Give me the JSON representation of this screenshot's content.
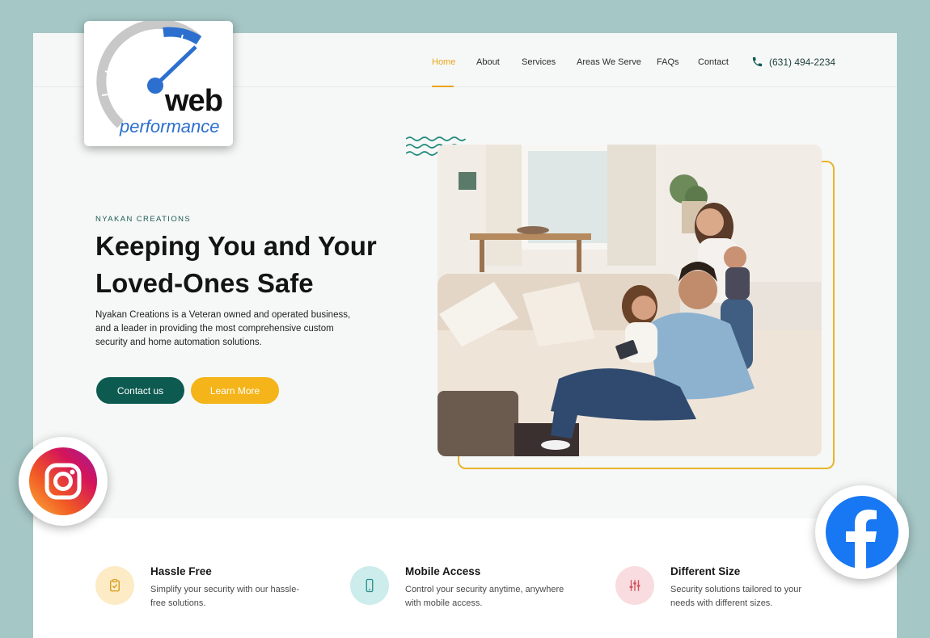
{
  "nav": {
    "links": [
      "Home",
      "About",
      "Services",
      "Areas We Serve",
      "FAQs",
      "Contact"
    ],
    "phone": "(631) 494-2234"
  },
  "hero": {
    "eyebrow": "NYAKAN CREATIONS",
    "headline_line1": "Keeping You and Your",
    "headline_line2": "Loved-Ones Safe",
    "intro": "Nyakan Creations is a Veteran owned and operated business, and a leader in providing the most comprehensive custom security and home automation solutions.",
    "primary_button": "Contact us",
    "secondary_button": "Learn More"
  },
  "features": [
    {
      "title": "Hassle Free",
      "desc_line1": "Simplify your security with our hassle-",
      "desc_line2": "free solutions.",
      "icon": "clipboard-check-icon"
    },
    {
      "title": "Mobile Access",
      "desc_line1": "Control your security anytime, anywhere",
      "desc_line2": "with mobile access.",
      "icon": "smartphone-icon"
    },
    {
      "title": "Different Size",
      "desc_line1": "Security solutions tailored to your",
      "desc_line2": "needs with different sizes.",
      "icon": "sliders-icon"
    }
  ],
  "badges": {
    "web_word": "web",
    "performance_word": "performance",
    "social": [
      "instagram-icon",
      "facebook-icon"
    ]
  },
  "colors": {
    "accent_teal": "#0d5b50",
    "accent_amber": "#f4b41a",
    "nav_active": "#e9a51a",
    "backdrop": "#a5c7c6"
  }
}
